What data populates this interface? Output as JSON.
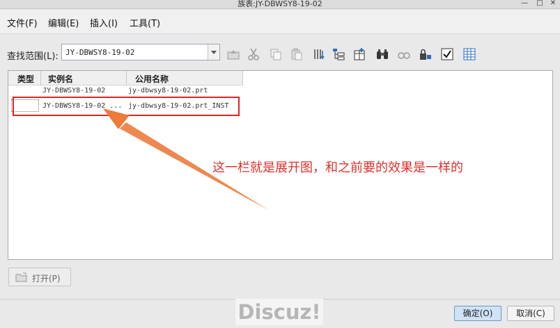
{
  "window": {
    "title": "族表:JY-DBWSY8-19-02"
  },
  "menu": [
    "文件(F)",
    "编辑(E)",
    "插入(I)",
    "工具(T)"
  ],
  "toolbar": {
    "lookin_label": "查找范围(L):",
    "lookin_value": "JY-DBWSY8-19-02",
    "icons": [
      "up-folder-icon",
      "cut-icon",
      "copy-icon",
      "paste-icon",
      "sort-icon",
      "tree-view-icon",
      "table-add-icon",
      "binoculars-find-icon",
      "glasses-preview-icon",
      "lock-icon",
      "verify-check-icon",
      "table-edit-icon"
    ]
  },
  "list": {
    "columns": [
      "类型",
      "实例名",
      "公用名称"
    ],
    "rows": [
      {
        "instance": "JY-DBWSY8-19-02",
        "common": "jy-dbwsy8-19-02.prt"
      },
      {
        "instance": "JY-DBWSY8-19-02 ...",
        "common": "jy-dbwsy8-19-02.prt_INST"
      }
    ]
  },
  "annotation": {
    "text": "这一栏就是展开图，和之前要的效果是一样的",
    "color": "#e0302a",
    "box_color": "#e02424",
    "arrow_color": "#ec7b3c"
  },
  "buttons": {
    "open": "打开(P)",
    "ok": "确定(O)",
    "cancel": "取消(C)"
  },
  "watermark": "Discuz!"
}
